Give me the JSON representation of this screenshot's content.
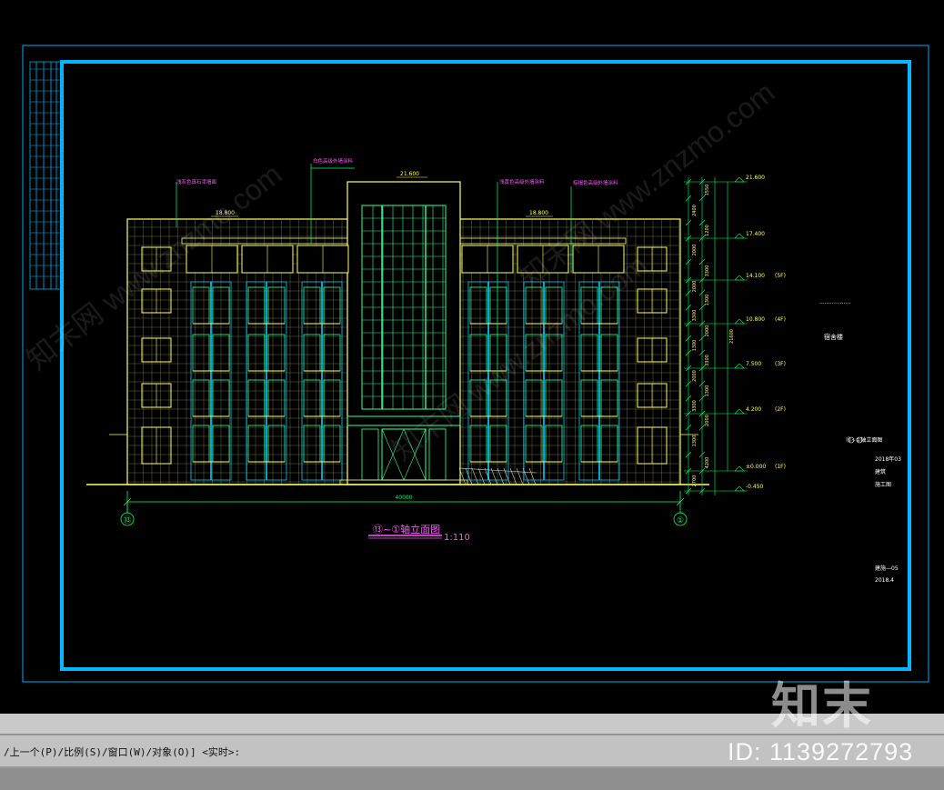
{
  "drawing": {
    "title_label": "⑬~①轴立面图",
    "scale_label": "1:110",
    "overall_dimension": "40000",
    "axis_left": "⑬",
    "axis_right": "①",
    "top_parapet_elevation": "21.600",
    "roof_elevation_left": "18.800",
    "roof_elevation_right": "18.800",
    "leader_labels": [
      "白色高级外墙涂料",
      "浅灰色真石漆墙面",
      "浅黄色高级外墙涂料",
      "棕褐色高级外墙涂料"
    ],
    "elevations": [
      {
        "value": "21.600",
        "floor": ""
      },
      {
        "value": "17.400",
        "floor": ""
      },
      {
        "value": "14.100",
        "floor": "(5F)"
      },
      {
        "value": "10.800",
        "floor": "(4F)"
      },
      {
        "value": "7.500",
        "floor": "(3F)"
      },
      {
        "value": "4.200",
        "floor": "(2F)"
      },
      {
        "value": "±0.000",
        "floor": "(1F)"
      },
      {
        "value": "-0.450",
        "floor": ""
      }
    ],
    "vertical_dims": [
      "1550",
      "2400",
      "1200",
      "2000",
      "3300",
      "2000",
      "1300",
      "3300",
      "2000",
      "1300",
      "3300",
      "2000",
      "1300",
      "3300",
      "2000",
      "1300",
      "4200",
      "2700",
      "1100",
      "450",
      "21600"
    ],
    "title_block": {
      "project_dots": "..................",
      "project_name": "宿舍楼",
      "sheet_title": "⑬~①轴立面图",
      "year": "2018年03",
      "discipline": "建筑",
      "stage": "施工图",
      "sheet_no": "建施—05",
      "date": "2018.4"
    }
  },
  "command_line": {
    "prompt": "/上一个(P)/比例(S)/窗口(W)/对象(O)] <实时>:"
  },
  "watermark": {
    "brand": "知末",
    "id_text": "ID: 1139272793",
    "site": "知末网 www.znzmo.com"
  },
  "colors": {
    "frame": "#00aeef",
    "building_outline": "#ffff66",
    "glazing": "#33ff99",
    "dimension": "#00ff66",
    "leader_text": "#ff55ff",
    "background": "#000000"
  }
}
